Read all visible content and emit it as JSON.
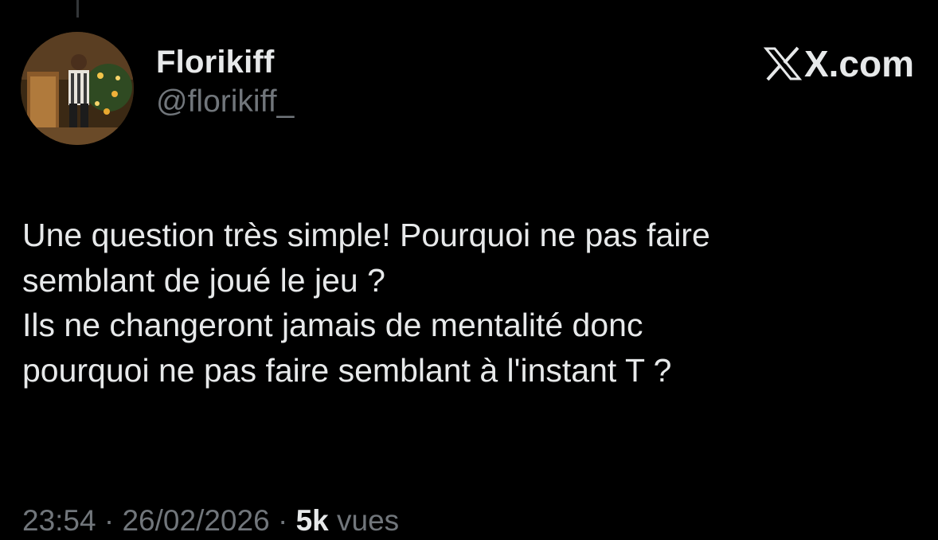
{
  "author": {
    "display_name": "Florikiff",
    "handle": "@florikiff_"
  },
  "brand": {
    "text": "X.com",
    "icon": "x-logo-icon"
  },
  "tweet": {
    "lines": [
      "Une question très simple! Pourquoi ne pas faire",
      "semblant de joué le jeu ?",
      "Ils ne changeront jamais de mentalité donc",
      "pourquoi ne pas faire semblant à l'instant T ?"
    ]
  },
  "meta": {
    "time": "23:54",
    "separator": " · ",
    "date": "26/02/2026",
    "views_count": "5k",
    "views_label": "vues"
  },
  "colors": {
    "background": "#000000",
    "primary_text": "#e7e9ea",
    "secondary_text": "#71767b"
  }
}
